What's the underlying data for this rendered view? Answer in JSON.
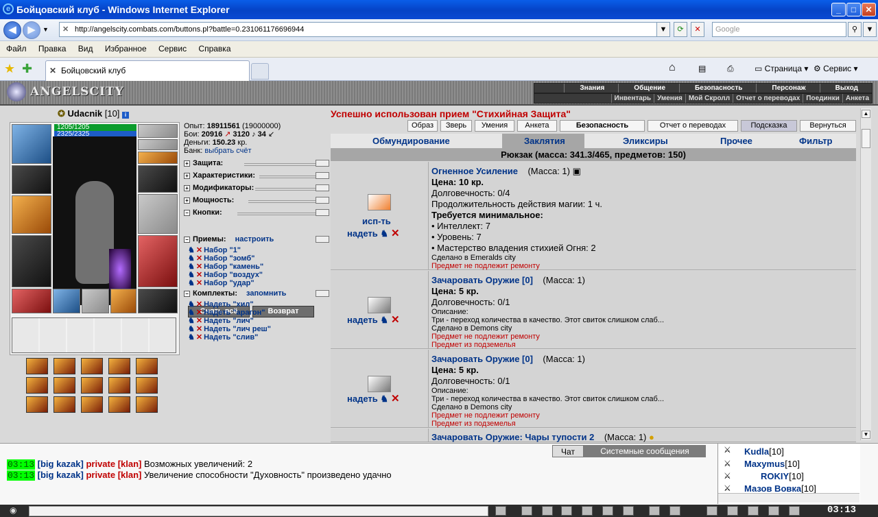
{
  "window": {
    "title": "Бойцовский клуб - Windows Internet Explorer"
  },
  "address": {
    "url": "http://angelscity.combats.com/buttons.pl?battle=0.231061176696944",
    "search_placeholder": "Google"
  },
  "menu": [
    "Файл",
    "Правка",
    "Вид",
    "Избранное",
    "Сервис",
    "Справка"
  ],
  "tab": {
    "title": "Бойцовский клуб"
  },
  "toolbar": {
    "page": "Страница",
    "service": "Сервис"
  },
  "game_nav": {
    "row1": [
      "Знания",
      "Общение",
      "Безопасность",
      "Персонаж",
      "Выход"
    ],
    "row2": [
      "Инвентарь",
      "Умения",
      "Мой Скролл",
      "Отчет о переводах",
      "Поединки",
      "Анкета"
    ]
  },
  "logo": "ANGELSCITY",
  "player": {
    "name": "Udacnik",
    "level": "[10]",
    "hp": "1205/1205",
    "mp": "2325/2325"
  },
  "stats": {
    "exp_label": "Опыт:",
    "exp": "18911561",
    "exp_next": "(19000000)",
    "fights_label": "Бои:",
    "wins": "20916",
    "losses": "3120",
    "draws": "34",
    "money_label": "Деньги:",
    "money": "150.23",
    "money_unit": "кр.",
    "bank_label": "Банк:",
    "bank_link": "выбрать счёт"
  },
  "sections": [
    "Защита:",
    "Характеристики:",
    "Модификаторы:",
    "Мощность:",
    "Кнопки:"
  ],
  "buttons": {
    "unequip_all": "Снять всё",
    "return": "Возврат"
  },
  "techniques": {
    "label": "Приемы:",
    "configure": "настроить",
    "items": [
      "Набор \"1\"",
      "Набор \"зомб\"",
      "Набор \"камень\"",
      "Набор \"воздух\"",
      "Набор \"удар\""
    ]
  },
  "sets": {
    "label": "Комплекты:",
    "remember": "запомнить",
    "items": [
      "Надеть \"хил\"",
      "Надеть \"арагон\"",
      "Надеть \"лич\"",
      "Надеть \"лич реш\"",
      "Надеть \"слив\""
    ]
  },
  "message": "Успешно использован прием \"Стихийная Защита\"",
  "actions": [
    "Образ",
    "Зверь",
    "Умения",
    "Анкета",
    "Безопасность",
    "Отчет о переводах",
    "Подсказка",
    "Вернуться"
  ],
  "inv_tabs": [
    "Обмундирование",
    "Заклятия",
    "Эликсиры",
    "Прочее",
    "Фильтр"
  ],
  "backpack": "Рюкзак (масса: 341.3/465, предметов: 150)",
  "items": [
    {
      "name": "Огненное Усиление",
      "mass": "(Масса: 1)",
      "use": "исп-ть",
      "wear": "надеть",
      "lines": [
        "Цена: 10 кр.",
        "Долговечность: 0/4",
        "Продолжительность действия магии: 1 ч.",
        "Требуется минимальное:",
        "• Интеллект: 7",
        "• Уровень: 7",
        "• Мастерство владения стихией Огня: 2"
      ],
      "made": "Сделано в Emeralds city",
      "notes": [
        "Предмет не подлежит ремонту"
      ]
    },
    {
      "name": "Зачаровать Оружие [0]",
      "mass": "(Масса: 1)",
      "wear": "надеть",
      "lines": [
        "Цена: 5 кр.",
        "Долговечность: 0/1"
      ],
      "desc_label": "Описание:",
      "desc": "Три - переход количества в качество. Этот свиток слишком слаб...",
      "made": "Сделано в Demons city",
      "notes": [
        "Предмет не подлежит ремонту",
        "Предмет из подземелья"
      ]
    },
    {
      "name": "Зачаровать Оружие [0]",
      "mass": "(Масса: 1)",
      "wear": "надеть",
      "lines": [
        "Цена: 5 кр.",
        "Долговечность: 0/1"
      ],
      "desc_label": "Описание:",
      "desc": "Три - переход количества в качество. Этот свиток слишком слаб...",
      "made": "Сделано в Demons city",
      "notes": [
        "Предмет не подлежит ремонту",
        "Предмет из подземелья"
      ]
    },
    {
      "name": "Зачаровать Оружие: Чары тупости 2",
      "mass": "(Масса: 1)"
    }
  ],
  "chat": {
    "tabs": [
      "Чат",
      "Системные сообщения"
    ],
    "lines": [
      {
        "time": "03:13",
        "user": "[big kazak]",
        "private": "private [klan]",
        "text": "Возможных увеличений: 2"
      },
      {
        "time": "03:13",
        "user": "[big kazak]",
        "private": "private [klan]",
        "text": "Увеличение способности \"Духовность\" произведено удачно"
      }
    ]
  },
  "users": [
    {
      "name": "Kudla",
      "level": "[10]"
    },
    {
      "name": "Maxymus",
      "level": "[10]"
    },
    {
      "name": "ROKIY",
      "level": "[10]"
    },
    {
      "name": "Мазов Вовка",
      "level": "[10]"
    }
  ],
  "clock": "03:13"
}
